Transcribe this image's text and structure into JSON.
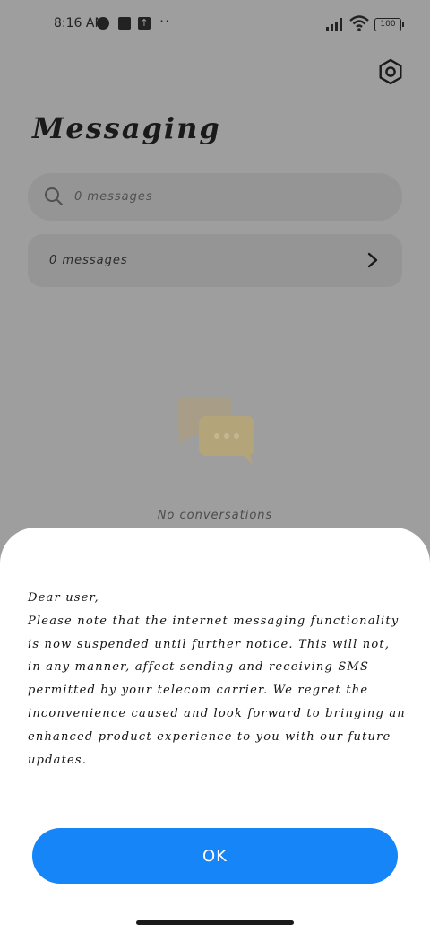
{
  "status_bar": {
    "time": "8:16 AM",
    "battery": "100"
  },
  "header": {
    "title": "Messaging",
    "settings_icon": "gear-icon"
  },
  "search": {
    "placeholder": "0 messages"
  },
  "messages_card": {
    "label": "0 messages"
  },
  "empty_state": {
    "text": "No conversations"
  },
  "dialog": {
    "greeting": "Dear user,",
    "body": "Please note that the internet messaging functionality is now suspended until further notice. This will not, in any manner, affect sending and receiving SMS permitted by your telecom carrier. We regret the inconvenience caused and look forward to bringing an enhanced product experience to you with our future updates.",
    "ok_label": "OK"
  },
  "colors": {
    "accent": "#1585f7",
    "dim_background": "#9e9e9e",
    "sheet": "#ffffff"
  }
}
